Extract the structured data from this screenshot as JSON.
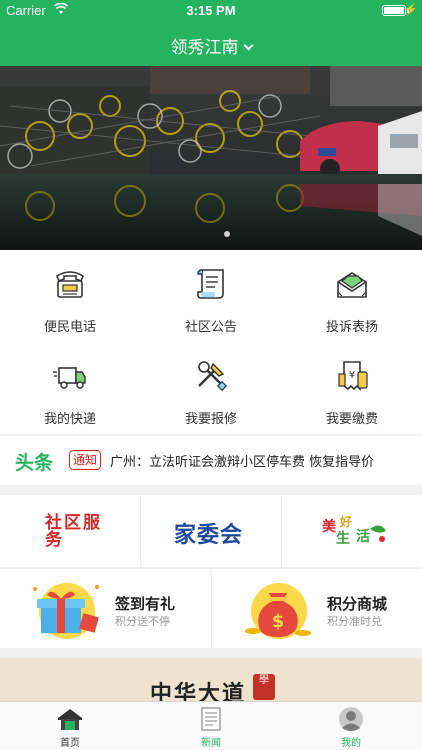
{
  "status": {
    "carrier": "Carrier",
    "time": "3:15 PM"
  },
  "nav": {
    "title": "领秀江南"
  },
  "services": [
    {
      "label": "便民电话",
      "icon": "telephone-icon"
    },
    {
      "label": "社区公告",
      "icon": "notice-scroll-icon"
    },
    {
      "label": "投诉表扬",
      "icon": "mail-envelope-icon"
    },
    {
      "label": "我的快递",
      "icon": "delivery-truck-icon"
    },
    {
      "label": "我要报修",
      "icon": "repair-tools-icon"
    },
    {
      "label": "我要缴费",
      "icon": "payment-receipt-icon"
    }
  ],
  "headline": {
    "brand": "头条",
    "tag": "通知",
    "text": "广州：立法听证会激辩小区停车费 恢复指导价"
  },
  "brands": {
    "community_service": "社区服务",
    "family_committee": "家委会",
    "beautiful_life": "美好生活"
  },
  "promos": [
    {
      "title": "签到有礼",
      "subtitle": "积分送不停",
      "icon": "gift-icon"
    },
    {
      "title": "积分商城",
      "subtitle": "积分准时兑",
      "icon": "money-bag-icon"
    }
  ],
  "ad": {
    "text": "中华大道",
    "seal": "學"
  },
  "tabs": [
    {
      "label": "首页",
      "icon": "home-icon"
    },
    {
      "label": "新闻",
      "icon": "news-icon"
    },
    {
      "label": "我的",
      "icon": "profile-icon"
    }
  ],
  "colors": {
    "brand_green": "#26b35f",
    "alert_red": "#e02020"
  }
}
